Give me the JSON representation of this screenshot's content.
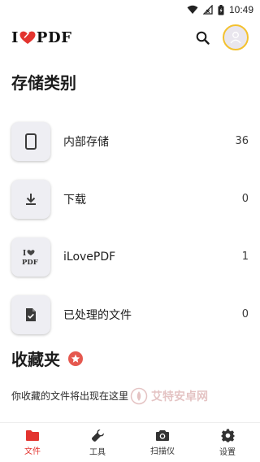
{
  "status_bar": {
    "time": "10:49"
  },
  "app_bar": {
    "logo_left": "I",
    "logo_right": "PDF"
  },
  "storage": {
    "title": "存储类别",
    "items": [
      {
        "label": "内部存储",
        "count": "36",
        "icon": "phone-icon"
      },
      {
        "label": "下载",
        "count": "0",
        "icon": "download-icon"
      },
      {
        "label": "iLovePDF",
        "count": "1",
        "icon": "ilovepdf-logo-icon"
      },
      {
        "label": "已处理的文件",
        "count": "0",
        "icon": "checked-file-icon"
      }
    ]
  },
  "favorites": {
    "title": "收藏夹",
    "empty_text": "你收藏的文件将出现在这里"
  },
  "watermark": {
    "text": "艾特安卓网"
  },
  "bottom_nav": {
    "items": [
      {
        "label": "文件",
        "icon": "folder-icon",
        "active": true
      },
      {
        "label": "工具",
        "icon": "wrench-icon",
        "active": false
      },
      {
        "label": "扫描仪",
        "icon": "camera-icon",
        "active": false
      },
      {
        "label": "设置",
        "icon": "gear-icon",
        "active": false
      }
    ]
  },
  "colors": {
    "accent": "#e3342f",
    "avatar_ring": "#f3c12f",
    "tile_bg": "#eeeef3"
  }
}
